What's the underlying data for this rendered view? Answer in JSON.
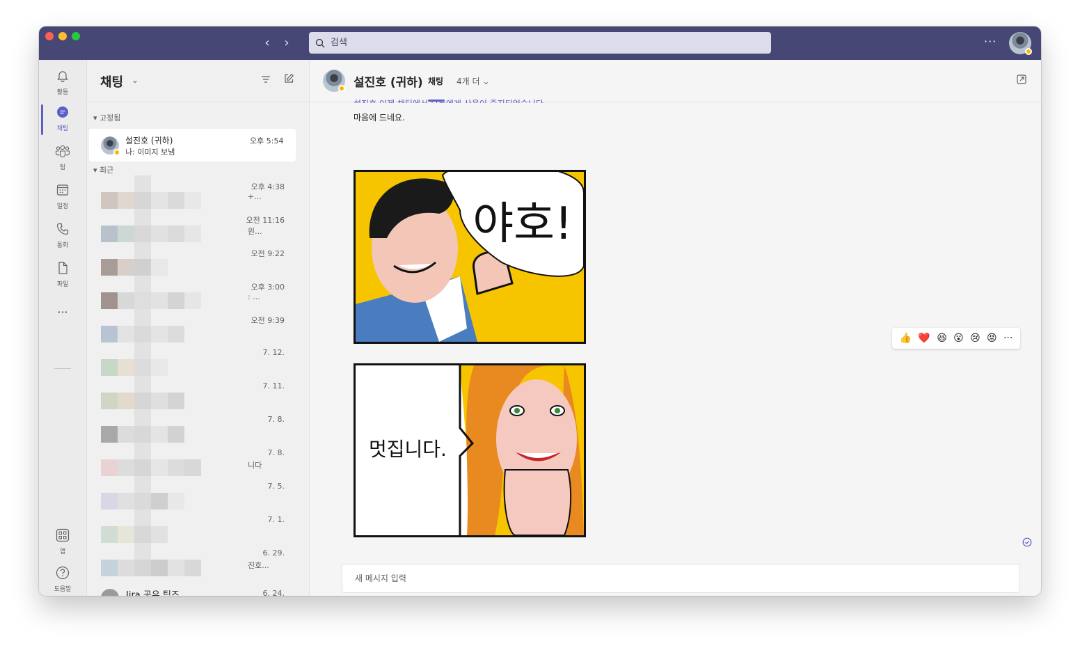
{
  "search": {
    "placeholder": "검색"
  },
  "titlebar": {
    "more": "···"
  },
  "rail": {
    "activity": "활동",
    "chat": "채팅",
    "teams": "팀",
    "calendar": "일정",
    "calls": "통화",
    "files": "파일",
    "more": "···",
    "apps": "앱",
    "help": "도움말"
  },
  "chat_list": {
    "title": "채팅",
    "pinned_label": "고정됨",
    "recent_label": "최근",
    "pinned": {
      "name": "설진호 (귀하)",
      "preview": "나: 이미지 보냄",
      "time": "오후 5:54"
    },
    "recent": [
      {
        "time": "오후 4:38",
        "frag": "+..."
      },
      {
        "time": "오전 11:16",
        "frag": "원..."
      },
      {
        "time": "오전 9:22",
        "frag": ""
      },
      {
        "time": "오후 3:00",
        "frag": ": ..."
      },
      {
        "time": "오전 9:39",
        "frag": ""
      },
      {
        "time": "7. 12.",
        "frag": ""
      },
      {
        "time": "7. 11.",
        "frag": ""
      },
      {
        "time": "7. 8.",
        "frag": ""
      },
      {
        "time": "7. 8.",
        "frag": "니다"
      },
      {
        "time": "7. 5.",
        "frag": ""
      },
      {
        "time": "7. 1.",
        "frag": ""
      },
      {
        "time": "6. 29.",
        "frag": "진호..."
      }
    ],
    "last": {
      "name": "Jira 공유 팀즈",
      "time": "6. 24."
    }
  },
  "chat": {
    "name": "설진호 (귀하)",
    "tab": "채팅",
    "more_tabs": "4개 더",
    "cut_message": "설진호  이제 채팅에서 모두에게 사용이 중지되었습니다.",
    "message": "마음에 드네요.",
    "comic1_text": "야호!",
    "comic2_text": "멋집니다.",
    "reactions": [
      "👍",
      "❤️",
      "😆",
      "😮",
      "😢",
      "😡",
      "···"
    ],
    "compose_placeholder": "새 메시지 입력"
  },
  "colors": {
    "titlebar": "#464775",
    "accent": "#5b5fc7",
    "comic_yellow": "#f7c400"
  }
}
